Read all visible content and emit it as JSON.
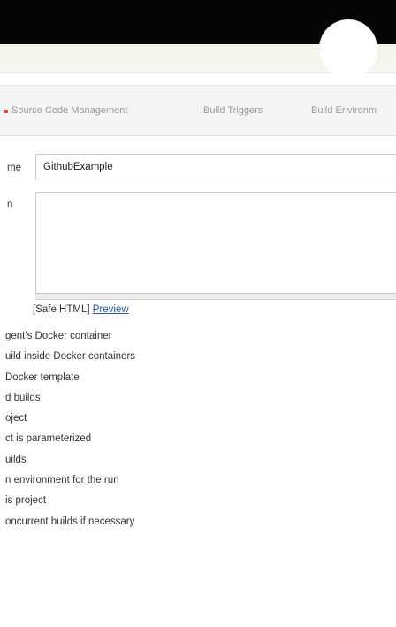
{
  "tabs": [
    {
      "label": "Source Code Management"
    },
    {
      "label": "Build Triggers"
    },
    {
      "label": "Build Environm"
    }
  ],
  "general": {
    "name_label": "me",
    "name_value": "GithubExample",
    "description_label": "n",
    "description_value": "",
    "safe_html_text": "[Safe HTML] ",
    "preview_label": "Preview"
  },
  "options": [
    {
      "label": "gent's Docker container"
    },
    {
      "label": "uild inside Docker containers"
    },
    {
      "label": "Docker template"
    },
    {
      "label": "d builds"
    },
    {
      "label": "oject"
    },
    {
      "label": "ct is parameterized"
    },
    {
      "label": "uilds"
    },
    {
      "label": "n environment for the run"
    },
    {
      "label": "is project"
    },
    {
      "label": "oncurrent builds if necessary"
    }
  ],
  "colors": {
    "header": "#050505",
    "subheader": "#f3f6ec",
    "tab_strip": "#f4f4f4",
    "tab_text": "#9a9a9a",
    "link": "#2d56b1",
    "marker": "#d24939"
  }
}
